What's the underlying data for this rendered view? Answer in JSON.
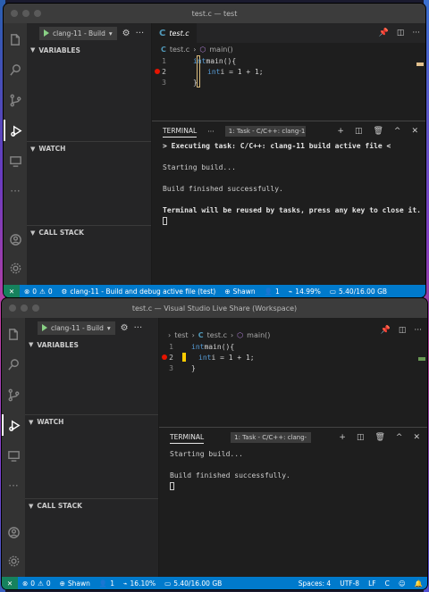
{
  "w1": {
    "title": "test.c — test",
    "debug": {
      "config": "clang-11 - Build"
    },
    "sections": [
      "VARIABLES",
      "WATCH",
      "CALL STACK"
    ],
    "tab": "test.c",
    "breadcrumb": {
      "file": "test.c",
      "symbol": "main()"
    },
    "code": [
      {
        "n": "1",
        "kw": "int",
        "rest": " main(){"
      },
      {
        "n": "2",
        "kw": "int",
        "rest": " i = 1 + 1;"
      },
      {
        "n": "3",
        "kw": "",
        "rest": "}"
      }
    ],
    "panel": {
      "title": "TERMINAL",
      "task": "1: Task - C/C++: clang-1"
    },
    "terminal": [
      "> Executing task: C/C++: clang-11 build active file <",
      "",
      "Starting build...",
      "",
      "Build finished successfully.",
      "",
      "Terminal will be reused by tasks, press any key to close it."
    ],
    "status": {
      "errors": "0",
      "warnings": "0",
      "debug": "clang-11 - Build and debug active file (test)",
      "user": "Shawn",
      "participants": "1",
      "cpu": "14.99%",
      "memory": "5.40/16.00 GB"
    }
  },
  "w2": {
    "title": "test.c — Visual Studio Live Share (Workspace)",
    "debug": {
      "config": "clang-11 - Build"
    },
    "sections": [
      "VARIABLES",
      "WATCH",
      "CALL STACK"
    ],
    "breadcrumb": {
      "folder": "test",
      "file": "test.c",
      "symbol": "main()"
    },
    "code": [
      {
        "n": "1",
        "kw": "int",
        "rest": " main(){"
      },
      {
        "n": "2",
        "kw": "int",
        "rest": " i = 1 + 1;"
      },
      {
        "n": "3",
        "kw": "",
        "rest": "}"
      }
    ],
    "panel": {
      "title": "TERMINAL",
      "task": "1: Task - C/C++: clang-"
    },
    "terminal": [
      "Starting build...",
      "",
      "Build finished successfully."
    ],
    "status": {
      "errors": "0",
      "warnings": "0",
      "user": "Shawn",
      "participants": "1",
      "cpu": "16.10%",
      "memory": "5.40/16.00 GB",
      "spaces": "Spaces: 4",
      "encoding": "UTF-8",
      "eol": "LF",
      "lang": "C"
    }
  },
  "colors": {
    "statusbar": "#007acc",
    "remote": "#16825d",
    "breakpoint": "#e51400",
    "keyword": "#569cd6"
  }
}
